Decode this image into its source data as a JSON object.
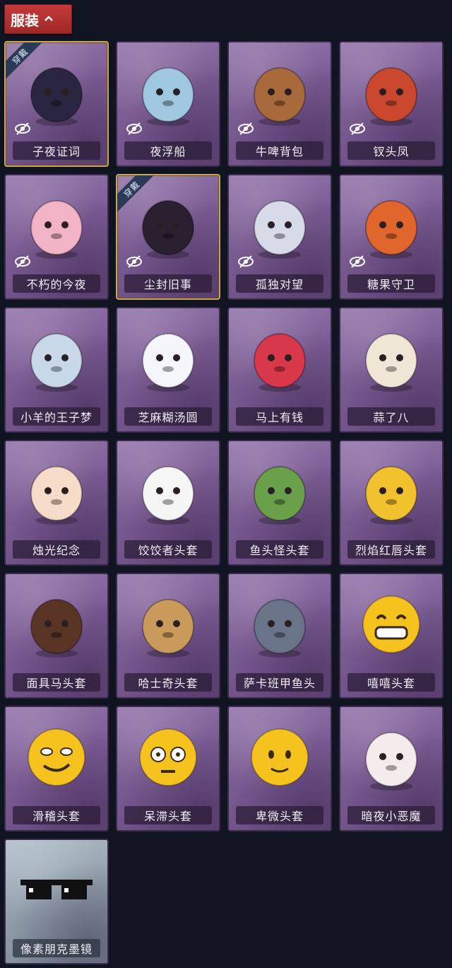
{
  "header": {
    "title": "服装",
    "toggle_icon": "chevron-up-icon"
  },
  "colors": {
    "header_bg": "#b53030",
    "card_purple": "#7b5c93",
    "card_silver": "#8f9ea9",
    "worn_border": "#c9a45a"
  },
  "items": [
    {
      "label": "子夜证词",
      "worn": true,
      "badge": "穿戴",
      "hidden_icon": true,
      "icon": "owl-costume-icon",
      "art_color": "#2a2540"
    },
    {
      "label": "夜浮船",
      "worn": false,
      "hidden_icon": true,
      "icon": "jellyfish-icon",
      "art_color": "#9fc7e0"
    },
    {
      "label": "牛啤背包",
      "worn": false,
      "hidden_icon": true,
      "icon": "cow-barrel-backpack-icon",
      "art_color": "#a86a3a"
    },
    {
      "label": "钗头凤",
      "worn": false,
      "hidden_icon": true,
      "icon": "phoenix-headdress-icon",
      "art_color": "#c9482e"
    },
    {
      "label": "不朽的今夜",
      "worn": false,
      "hidden_icon": true,
      "icon": "fox-sundae-charm-icon",
      "art_color": "#f2b4c4"
    },
    {
      "label": "尘封旧事",
      "worn": true,
      "badge": "穿戴",
      "hidden_icon": true,
      "icon": "chibi-doll-charm-icon",
      "art_color": "#2b2030"
    },
    {
      "label": "孤独对望",
      "worn": false,
      "hidden_icon": true,
      "icon": "silver-hair-doll-charm-icon",
      "art_color": "#d7dbe8"
    },
    {
      "label": "糖果守卫",
      "worn": false,
      "hidden_icon": true,
      "icon": "pumpkin-scarecrow-charm-icon",
      "art_color": "#e0662e"
    },
    {
      "label": "小羊的王子梦",
      "worn": false,
      "hidden_icon": false,
      "icon": "sheep-crown-icon",
      "art_color": "#c9d8e8"
    },
    {
      "label": "芝麻糊汤圆",
      "worn": false,
      "hidden_icon": false,
      "icon": "rice-ball-icon",
      "art_color": "#f4f6fb"
    },
    {
      "label": "马上有钱",
      "worn": false,
      "hidden_icon": false,
      "icon": "red-horse-icon",
      "art_color": "#d8384a"
    },
    {
      "label": "蒜了八",
      "worn": false,
      "hidden_icon": false,
      "icon": "garlic-icon",
      "art_color": "#efe6d6"
    },
    {
      "label": "烛光纪念",
      "worn": false,
      "hidden_icon": false,
      "icon": "candle-icon",
      "art_color": "#f6dcc8"
    },
    {
      "label": "饺饺者头套",
      "worn": false,
      "hidden_icon": false,
      "icon": "dumpling-icon",
      "art_color": "#f5f5f5"
    },
    {
      "label": "鱼头怪头套",
      "worn": false,
      "hidden_icon": false,
      "icon": "fish-head-icon",
      "art_color": "#6aa04a"
    },
    {
      "label": "烈焰红唇头套",
      "worn": false,
      "hidden_icon": false,
      "icon": "yellow-mask-sunglasses-icon",
      "art_color": "#f2c22e"
    },
    {
      "label": "面具马头套",
      "worn": false,
      "hidden_icon": false,
      "icon": "horse-mask-icon",
      "art_color": "#5a3424"
    },
    {
      "label": "哈士奇头套",
      "worn": false,
      "hidden_icon": false,
      "icon": "husky-sunglasses-icon",
      "art_color": "#c99a5a"
    },
    {
      "label": "萨卡班甲鱼头",
      "worn": false,
      "hidden_icon": false,
      "icon": "armored-fish-icon",
      "art_color": "#6a7488"
    },
    {
      "label": "嘻嘻头套",
      "worn": false,
      "hidden_icon": false,
      "icon": "grinning-emoji-icon",
      "art_color": "#f6c21e"
    },
    {
      "label": "滑稽头套",
      "worn": false,
      "hidden_icon": false,
      "icon": "smirk-emoji-icon",
      "art_color": "#f6c21e"
    },
    {
      "label": "呆滞头套",
      "worn": false,
      "hidden_icon": false,
      "icon": "dazed-emoji-icon",
      "art_color": "#f6c21e"
    },
    {
      "label": "卑微头套",
      "worn": false,
      "hidden_icon": false,
      "icon": "humble-emoji-icon",
      "art_color": "#f6c21e"
    },
    {
      "label": "暗夜小恶魔",
      "worn": false,
      "hidden_icon": false,
      "icon": "little-devil-icon",
      "art_color": "#f4ecec"
    },
    {
      "label": "像素朋克墨镜",
      "worn": false,
      "hidden_icon": false,
      "icon": "pixel-sunglasses-icon",
      "art_color": "#111111",
      "silver": true
    }
  ]
}
